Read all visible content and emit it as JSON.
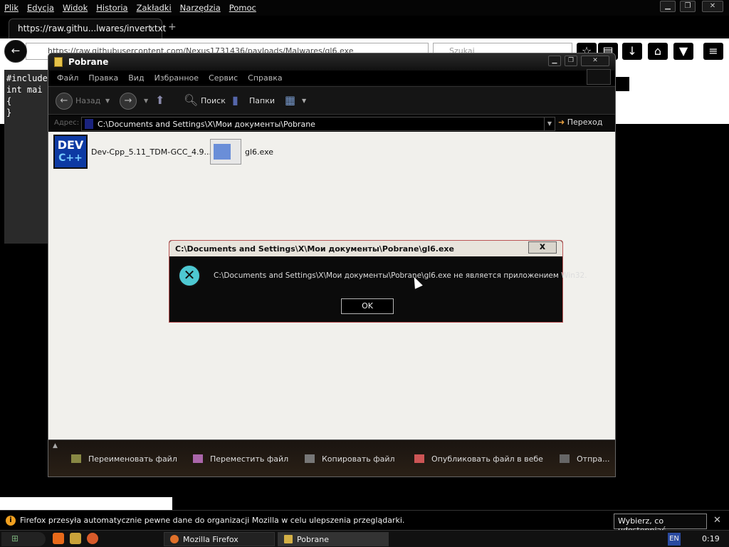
{
  "firefox": {
    "menu": [
      "Plik",
      "Edycja",
      "Widok",
      "Historia",
      "Zakładki",
      "Narzędzia",
      "Pomoc"
    ],
    "tab_title": "https://raw.githu...lwares/invert.txt",
    "tab_close": "x",
    "new_tab": "+",
    "url": "https://raw.githubusercontent.com/Nexus1731436/payloads/Malwares/gl6.exe",
    "search_placeholder": "Szukaj"
  },
  "page": {
    "code_lines": [
      "#include",
      "",
      "int mai",
      "{",
      "",
      "",
      "",
      "",
      "",
      "",
      "",
      "",
      "",
      "",
      "}"
    ]
  },
  "explorer": {
    "title": "Pobrane",
    "menu": [
      "Файл",
      "Правка",
      "Вид",
      "Избранное",
      "Сервис",
      "Справка"
    ],
    "toolbar": {
      "back": "Назад",
      "search": "Поиск",
      "folders": "Папки"
    },
    "address_label": "Адрес:",
    "address": "C:\\Documents and Settings\\X\\Мои документы\\Pobrane",
    "go": "Переход",
    "files": [
      {
        "name": "Dev-Cpp_5.11_TDM-GCC_4.9...",
        "icon_text": "DEV",
        "icon_sub": "C++"
      },
      {
        "name": "gl6.exe"
      }
    ],
    "tasks": [
      "Переименовать файл",
      "Переместить файл",
      "Копировать файл",
      "Опубликовать файл в вебе",
      "Отпра..."
    ]
  },
  "dialog": {
    "title": "C:\\Documents and Settings\\X\\Мои документы\\Pobrane\\gl6.exe",
    "close": "x",
    "icon": "error-icon",
    "message": "C:\\Documents and Settings\\X\\Мои документы\\Pobrane\\gl6.exe не является приложением Win32.",
    "ok": "OK"
  },
  "notification": {
    "icon": "i",
    "text": "Firefox przesyła automatycznie pewne dane do organizacji Mozilla w celu ulepszenia przeglądarki.",
    "button": "Wybierz, co udostępniać",
    "close": "✕"
  },
  "taskbar": {
    "items": [
      "Mozilla Firefox",
      "Pobrane"
    ],
    "lang": "EN",
    "clock": "0:19"
  }
}
